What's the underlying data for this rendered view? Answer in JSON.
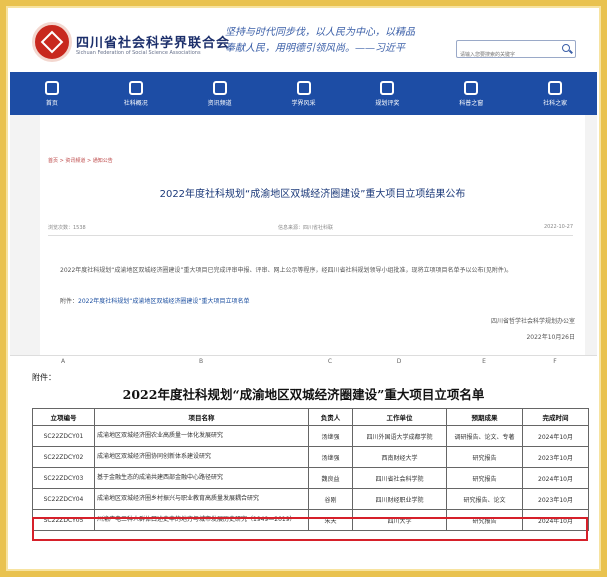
{
  "header": {
    "org_name_cn": "四川省社会科学界联合会",
    "org_name_en": "Sichuan Federation of Social Science Associations",
    "slogan_line1": "坚持与时代同步伐，以人民为中心，以精品",
    "slogan_line2": "奉献人民，用明德引领风尚。——习近平",
    "search_placeholder": "请输入您要搜索的关键字"
  },
  "nav": {
    "items": [
      {
        "label": "首页",
        "icon": "home-icon"
      },
      {
        "label": "社科概况",
        "icon": "building-icon"
      },
      {
        "label": "资讯频道",
        "icon": "news-icon"
      },
      {
        "label": "学界风采",
        "icon": "people-icon"
      },
      {
        "label": "规划评奖",
        "icon": "chart-icon"
      },
      {
        "label": "科普之窗",
        "icon": "atom-icon"
      },
      {
        "label": "社科之家",
        "icon": "house-icon"
      }
    ]
  },
  "article": {
    "breadcrumb": "首页 > 资讯频道 > 通知公告",
    "title": "2022年度社科规划“成渝地区双城经济圈建设”重大项目立项结果公布",
    "views": "浏览次数：1538",
    "source": "信息来源：四川省社科联",
    "date": "2022-10-27",
    "body": "2022年度社科规划“成渝地区双城经济圈建设”重大项目已完成评审申报、评审、网上公示等程序，经四川省社科规划领导小组批准，现将立项项目名单予以公布(见附件)。",
    "attach_prefix": "附件：",
    "attach_link": "2022年度社科规划“成渝地区双城经济圈建设”重大项目立项名单",
    "signer": "四川省哲学社会科学规划办公室",
    "sign_date": "2022年10月26日"
  },
  "sheet": {
    "col_letters": [
      "A",
      "B",
      "C",
      "D",
      "E",
      "F"
    ],
    "attach_label": "附件：",
    "title": "2022年度社科规划“成渝地区双城经济圈建设”重大项目立项名单",
    "headers": [
      "立项编号",
      "项目名称",
      "负责人",
      "工作单位",
      "预期成果",
      "完成时间"
    ],
    "rows": [
      {
        "id": "SC22ZDCY01",
        "name": "成渝地区双城经济圈农业高质量一体化发展研究",
        "leader": "汤继强",
        "unit": "四川外国语大学成都学院",
        "outcome": "调研报告、论文、专著",
        "due": "2024年10月"
      },
      {
        "id": "SC22ZDCY02",
        "name": "成渝地区双城经济圈协同创新体系建设研究",
        "leader": "汤继强",
        "unit": "西南财经大学",
        "outcome": "研究报告",
        "due": "2023年10月"
      },
      {
        "id": "SC22ZDCY03",
        "name": "基于金融生态的成渝共建西部金融中心路径研究",
        "leader": "魏良益",
        "unit": "四川省社会科学院",
        "outcome": "研究报告",
        "due": "2024年10月"
      },
      {
        "id": "SC22ZDCY04",
        "name": "成渝地区双城经济圈乡村振兴与职业教育高质量发展耦合研究",
        "leader": "谷刚",
        "unit": "四川财经职业学院",
        "outcome": "研究报告、论文",
        "due": "2023年10月"
      },
      {
        "id": "SC22ZDCY05",
        "name": "川渝广电三种人群体口述史中的地方与城市发展历史研究（1949—2019）",
        "leader": "朱天",
        "unit": "四川大学",
        "outcome": "研究报告",
        "due": "2024年10月"
      }
    ],
    "highlighted_row": "SC22ZDCY04"
  },
  "colors": {
    "nav_bg": "#1d4da5",
    "frame": "#e9c24f",
    "highlight": "#d6202a",
    "title_blue": "#1c3a7a"
  }
}
